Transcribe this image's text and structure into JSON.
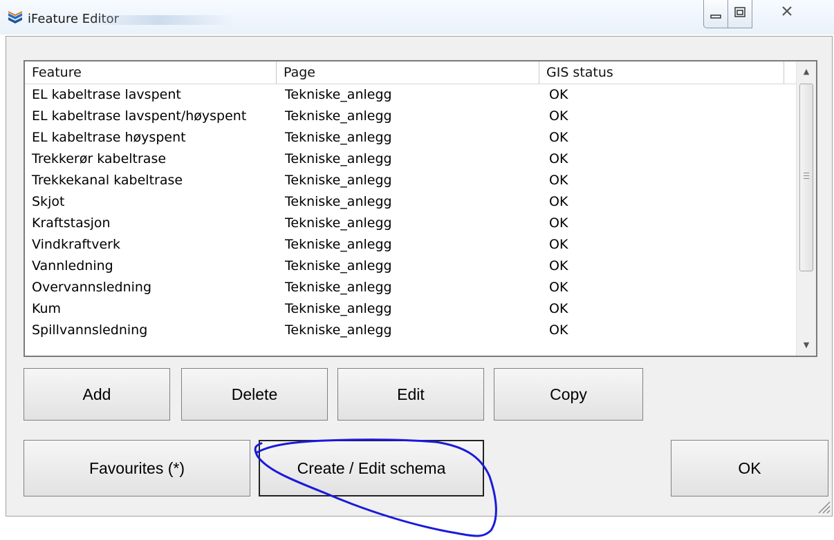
{
  "window": {
    "title": "iFeature Editor",
    "icon": "ifeature-app-icon",
    "controls": [
      "minimize-icon",
      "maximize-icon",
      "close-icon"
    ]
  },
  "list": {
    "columns": [
      "Feature",
      "Page",
      "GIS status"
    ],
    "rows": [
      [
        "EL kabeltrase lavspent",
        "Tekniske_anlegg",
        "OK"
      ],
      [
        "EL kabeltrase lavspent/høyspent",
        "Tekniske_anlegg",
        "OK"
      ],
      [
        "EL kabeltrase høyspent",
        "Tekniske_anlegg",
        "OK"
      ],
      [
        "Trekkerør kabeltrase",
        "Tekniske_anlegg",
        "OK"
      ],
      [
        "Trekkekanal kabeltrase",
        "Tekniske_anlegg",
        "OK"
      ],
      [
        "Skjot",
        "Tekniske_anlegg",
        "OK"
      ],
      [
        "Kraftstasjon",
        "Tekniske_anlegg",
        "OK"
      ],
      [
        "Vindkraftverk",
        "Tekniske_anlegg",
        "OK"
      ],
      [
        "Vannledning",
        "Tekniske_anlegg",
        "OK"
      ],
      [
        "Overvannsledning",
        "Tekniske_anlegg",
        "OK"
      ],
      [
        "Kum",
        "Tekniske_anlegg",
        "OK"
      ],
      [
        "Spillvannsledning",
        "Tekniske_anlegg",
        "OK"
      ]
    ]
  },
  "buttons": {
    "add": "Add",
    "delete": "Delete",
    "edit": "Edit",
    "copy": "Copy",
    "favourites": "Favourites (*)",
    "create_edit_schema": "Create / Edit schema",
    "ok": "OK"
  },
  "colors": {
    "annotation_stroke": "#1a1adb",
    "dialog_background": "#f0f0f0"
  }
}
